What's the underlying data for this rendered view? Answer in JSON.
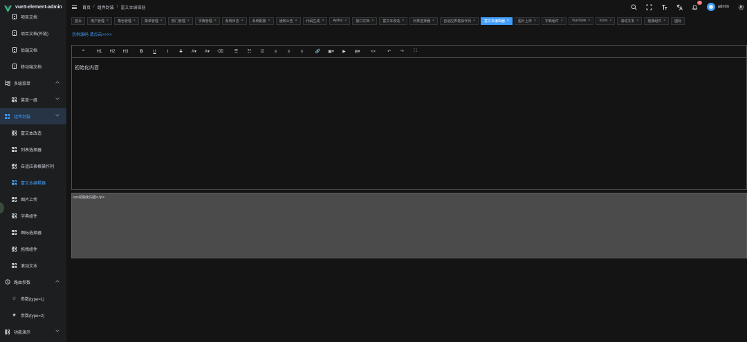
{
  "app": {
    "title": "vue3-element-admin"
  },
  "colors": {
    "accent": "#409eff",
    "badge": "#f56c6c",
    "sidebar_bg": "#1d1e1f",
    "page_bg": "#141414"
  },
  "sidebar": {
    "items": [
      {
        "label": "项目文档",
        "icon": "document-icon",
        "level": 2
      },
      {
        "label": "项目文档(外链)",
        "icon": "document-icon",
        "level": 2
      },
      {
        "label": "后端文档",
        "icon": "document-icon",
        "level": 2
      },
      {
        "label": "移动端文档",
        "icon": "document-icon",
        "level": 2
      },
      {
        "label": "多级菜单",
        "icon": "tree-icon",
        "level": 1,
        "chevron": "^"
      },
      {
        "label": "菜单一级",
        "icon": "grid-icon",
        "level": 2,
        "chevron": "v"
      },
      {
        "label": "组件封装",
        "icon": "grid-icon",
        "level": 1,
        "chevron": "v",
        "open": true
      },
      {
        "label": "富文本改造",
        "icon": "grid-icon",
        "level": 2
      },
      {
        "label": "列表选择器",
        "icon": "grid-icon",
        "level": 2
      },
      {
        "label": "自适应表格操作列",
        "icon": "grid-icon",
        "level": 2
      },
      {
        "label": "富文本编辑器",
        "icon": "grid-icon",
        "level": 2,
        "active": true
      },
      {
        "label": "图片上传",
        "icon": "grid-icon",
        "level": 2
      },
      {
        "label": "字典组件",
        "icon": "grid-icon",
        "level": 2
      },
      {
        "label": "图标选择器",
        "icon": "grid-icon",
        "level": 2
      },
      {
        "label": "拖拽组件",
        "icon": "grid-icon",
        "level": 2
      },
      {
        "label": "滚动文本",
        "icon": "grid-icon",
        "level": 2
      },
      {
        "label": "路由参数",
        "icon": "route-icon",
        "level": 1,
        "chevron": "^"
      },
      {
        "label": "参数(type=1)",
        "icon": "star-outline-icon",
        "level": 2
      },
      {
        "label": "参数(type=2)",
        "icon": "star-filled-icon",
        "level": 2
      },
      {
        "label": "功能演示",
        "icon": "grid-icon",
        "level": 1,
        "chevron": "v"
      }
    ]
  },
  "header": {
    "breadcrumb": [
      "首页",
      "组件封装",
      "富文本编辑器"
    ],
    "notification_count": "9",
    "username": "admin"
  },
  "tags": [
    {
      "label": "首页",
      "closable": false
    },
    {
      "label": "用户管理",
      "closable": true
    },
    {
      "label": "角色管理",
      "closable": true
    },
    {
      "label": "菜单管理",
      "closable": true
    },
    {
      "label": "部门管理",
      "closable": true
    },
    {
      "label": "字典管理",
      "closable": true
    },
    {
      "label": "系统日志",
      "closable": true
    },
    {
      "label": "系统配置",
      "closable": true
    },
    {
      "label": "通知公告",
      "closable": true
    },
    {
      "label": "代码生成",
      "closable": true
    },
    {
      "label": "Apifox",
      "closable": true
    },
    {
      "label": "接口文档",
      "closable": true
    },
    {
      "label": "富文本改造",
      "closable": true
    },
    {
      "label": "列表选择器",
      "closable": true
    },
    {
      "label": "自适应表格操作列",
      "closable": true
    },
    {
      "label": "富文本编辑器",
      "closable": true,
      "active": true
    },
    {
      "label": "图片上传",
      "closable": true
    },
    {
      "label": "字典组件",
      "closable": true
    },
    {
      "label": "VueTable",
      "closable": true
    },
    {
      "label": "Icons",
      "closable": true
    },
    {
      "label": "滚动文本",
      "closable": true
    },
    {
      "label": "拖拽组件",
      "closable": true
    },
    {
      "label": "图标",
      "closable": false
    }
  ],
  "main": {
    "demo_link": "示例源码 请点击>>>>",
    "editor_content": "初始化内容",
    "source_html": "<p>初始化内容</p>",
    "toolbar": [
      {
        "name": "quote-button",
        "text": "❝"
      },
      {
        "name": "h1-button",
        "text": "H1"
      },
      {
        "name": "h2-button",
        "text": "H2"
      },
      {
        "name": "h3-button",
        "text": "H3"
      },
      {
        "name": "bold-button",
        "text": "B"
      },
      {
        "name": "underline-button",
        "text": "U"
      },
      {
        "name": "italic-button",
        "text": "I"
      },
      {
        "name": "strikethrough-button",
        "text": "S"
      },
      {
        "name": "font-color-button",
        "text": "A▾"
      },
      {
        "name": "bg-color-button",
        "text": "A▾"
      },
      {
        "name": "clear-style-button",
        "text": "⌫"
      },
      {
        "name": "bulleted-list-button",
        "text": "☰"
      },
      {
        "name": "numbered-list-button",
        "text": "☷"
      },
      {
        "name": "todo-button",
        "text": "☑"
      },
      {
        "name": "align-left-button",
        "text": "≡"
      },
      {
        "name": "align-center-button",
        "text": "≡"
      },
      {
        "name": "justify-button",
        "text": "≡"
      },
      {
        "name": "link-button",
        "text": "🔗"
      },
      {
        "name": "image-button",
        "text": "▣▾"
      },
      {
        "name": "video-button",
        "text": "▶"
      },
      {
        "name": "table-button",
        "text": "⊞▾"
      },
      {
        "name": "code-button",
        "text": "<>"
      },
      {
        "name": "undo-button",
        "text": "↶"
      },
      {
        "name": "redo-button",
        "text": "↷"
      },
      {
        "name": "fullscreen-button",
        "text": "⛶"
      }
    ]
  }
}
